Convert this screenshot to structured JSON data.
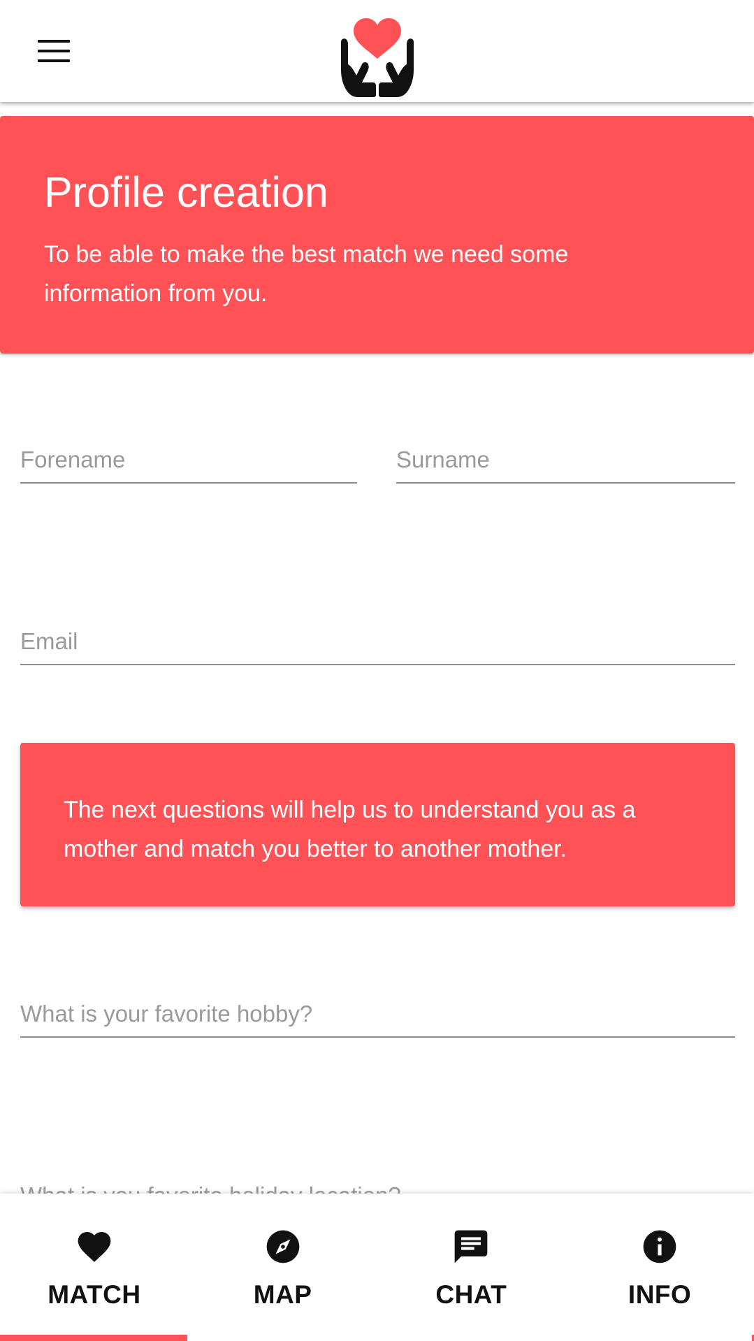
{
  "colors": {
    "accent": "#ff5257",
    "text": "#111111",
    "placeholder": "#9a9a9a",
    "underline": "#8c8c8c",
    "background": "#ffffff"
  },
  "appbar": {
    "menu_icon": "hamburger-menu-icon",
    "logo_icon": "heart-in-hands-logo"
  },
  "hero": {
    "title": "Profile creation",
    "description": "To be able to make the best match we need some information from you."
  },
  "form": {
    "forename": {
      "placeholder": "Forename",
      "value": ""
    },
    "surname": {
      "placeholder": "Surname",
      "value": ""
    },
    "email": {
      "placeholder": "Email",
      "value": ""
    },
    "info_text": "The next questions will help us to understand you as a mother and match you better to another mother.",
    "hobby": {
      "placeholder": "What is your favorite hobby?",
      "value": ""
    },
    "holiday": {
      "placeholder": "What is you favorite holiday location?",
      "value": ""
    }
  },
  "bottom_nav": {
    "active": "MATCH",
    "items": [
      {
        "label": "MATCH",
        "icon": "heart-icon"
      },
      {
        "label": "MAP",
        "icon": "compass-icon"
      },
      {
        "label": "CHAT",
        "icon": "chat-icon"
      },
      {
        "label": "INFO",
        "icon": "info-icon"
      }
    ]
  }
}
